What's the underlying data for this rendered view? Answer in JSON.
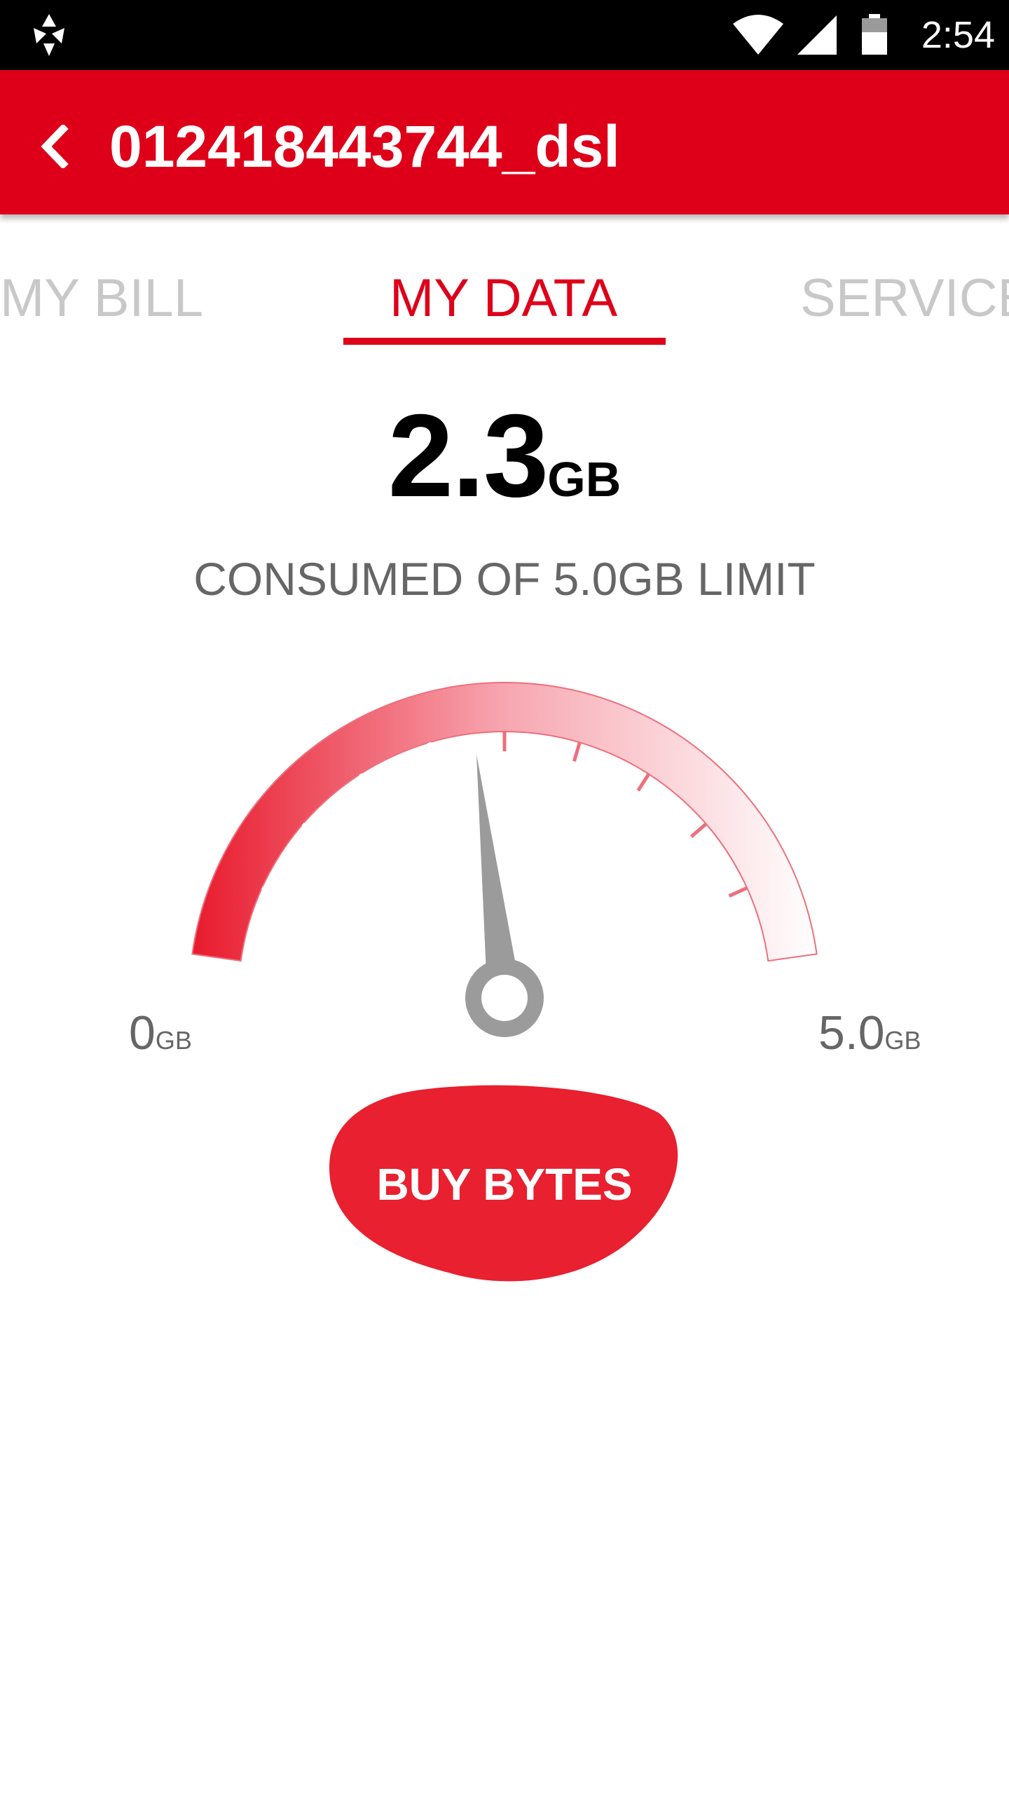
{
  "status_bar": {
    "time": "2:54",
    "icons": [
      "notification-icon",
      "wifi-icon",
      "cell-signal-icon",
      "battery-icon"
    ]
  },
  "app_bar": {
    "title": "012418443744_dsl",
    "back_icon": "chevron-left-icon",
    "background_color": "#de0019"
  },
  "tabs": [
    {
      "label": "MY BILL",
      "selected": false
    },
    {
      "label": "MY DATA",
      "selected": true
    },
    {
      "label": "SERVICE",
      "selected": false
    }
  ],
  "usage": {
    "amount": "2.3",
    "unit": "GB",
    "limit_text": "CONSUMED OF 5.0GB LIMIT"
  },
  "gauge": {
    "min_value": "0",
    "min_unit": "GB",
    "max_value": "5.0",
    "max_unit": "GB",
    "current": 2.3,
    "max": 5.0,
    "tick_count": 9,
    "accent_color": "#e8192c",
    "needle_color": "#9b9b9b"
  },
  "buy_button": {
    "label": "BUY BYTES",
    "color": "#e8202f"
  }
}
